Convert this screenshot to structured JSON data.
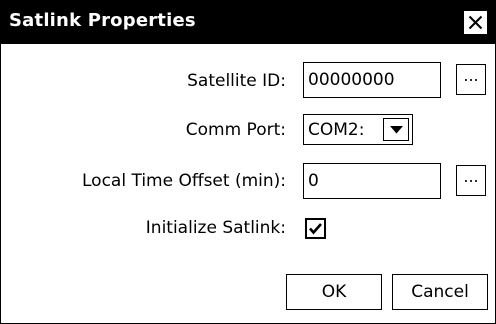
{
  "dialog": {
    "title": "Satlink Properties",
    "close_icon": "close-icon"
  },
  "fields": {
    "satellite_id": {
      "label": "Satellite ID:",
      "value": "00000000",
      "browse_label": "..."
    },
    "comm_port": {
      "label": "Comm Port:",
      "selected": "COM2:",
      "arrow_icon": "chevron-down-icon"
    },
    "local_time_offset": {
      "label": "Local Time Offset (min):",
      "value": "0",
      "browse_label": "..."
    },
    "initialize_satlink": {
      "label": "Initialize Satlink:",
      "checked": true,
      "check_icon": "checkmark-icon"
    }
  },
  "buttons": {
    "ok_label": "OK",
    "cancel_label": "Cancel"
  }
}
